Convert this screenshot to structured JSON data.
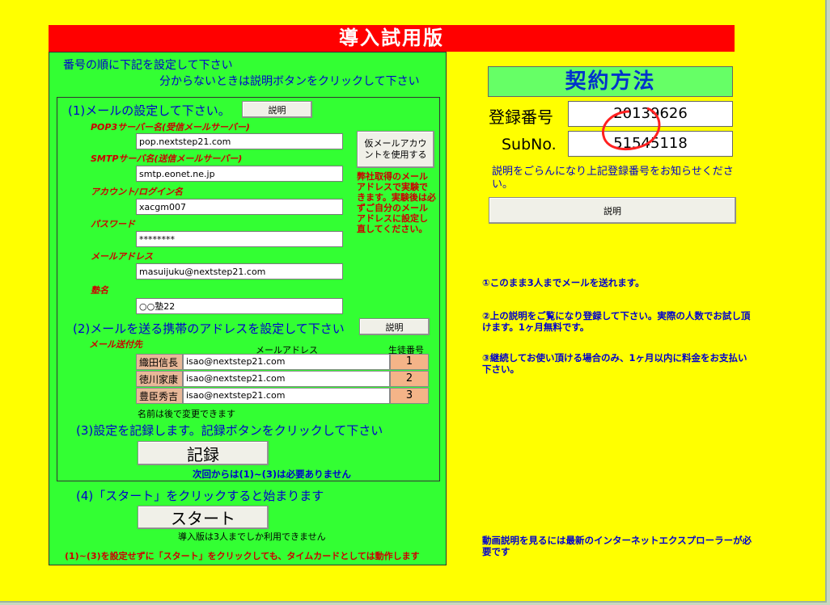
{
  "title": "導入試用版",
  "left": {
    "intro1": "番号の順に下記を設定して下さい",
    "intro2": "分からないときは説明ボタンをクリックして下さい",
    "step1": "(1)メールの設定して下さい。",
    "explain_label": "説明",
    "pop3_label": "POP3サーバー名(受信メールサーバー)",
    "pop3_value": "pop.nextstep21.com",
    "smtp_label": "SMTPサーバ名(送信メールサーバー)",
    "smtp_value": "smtp.eonet.ne.jp",
    "account_label": "アカウント/ログイン名",
    "account_value": "xacgm007",
    "password_label": "パスワード",
    "password_value": "********",
    "mail_label": "メールアドレス",
    "mail_value": "masuijuku@nextstep21.com",
    "juku_label": "塾名",
    "juku_value": "○○塾22",
    "temp_button": "仮メールアカウントを使用する",
    "temp_note": "弊社取得のメールアドレスで実験できます。実験後は必ずご自分のメールアドレスに設定し直してください。",
    "step2": "(2)メールを送る携帯のアドレスを設定して下さい",
    "send_to_label": "メール送付先",
    "col_mail": "メールアドレス",
    "col_num": "生徒番号",
    "rows": [
      {
        "name": "織田信長",
        "mail": "isao@nextstep21.com",
        "num": "1"
      },
      {
        "name": "徳川家康",
        "mail": "isao@nextstep21.com",
        "num": "2"
      },
      {
        "name": "豊臣秀吉",
        "mail": "isao@nextstep21.com",
        "num": "3"
      }
    ],
    "name_note": "名前は後で変更できます",
    "step3": "(3)設定を記録します。記録ボタンをクリックして下さい",
    "record_button": "記録",
    "record_note": "次回からは(1)~(3)は必要ありません",
    "step4": "(4)「スタート」をクリックすると始まります",
    "start_button": "スタート",
    "start_note": "導入版は3人までしか利用できません",
    "bottom_note": "(1)~(3)を設定せずに「スタート」をクリックしても、タイムカードとしては動作します"
  },
  "right": {
    "contract_title": "契約方法",
    "reg_label": "登録番号",
    "reg_value": "20139626",
    "sub_label": "SubNo.",
    "sub_value": "51545118",
    "explain_text": "説明をごらんになり上記登録番号をお知らせください。",
    "explain_button": "説明",
    "note1": "①このまま3人までメールを送れます。",
    "note2": "②上の説明をご覧になり登録して下さい。実際の人数でお試し頂けます。1ヶ月無料です。",
    "note3": "③継続してお使い頂ける場合のみ、1ヶ月以内に料金をお支払い下さい。",
    "note4": "動画説明を見るには最新のインターネットエクスプローラーが必要です"
  },
  "colors": {
    "sheet": "#ffff00",
    "panel": "#33ff33",
    "title": "#ff0000",
    "annotation": "#ff2020"
  }
}
